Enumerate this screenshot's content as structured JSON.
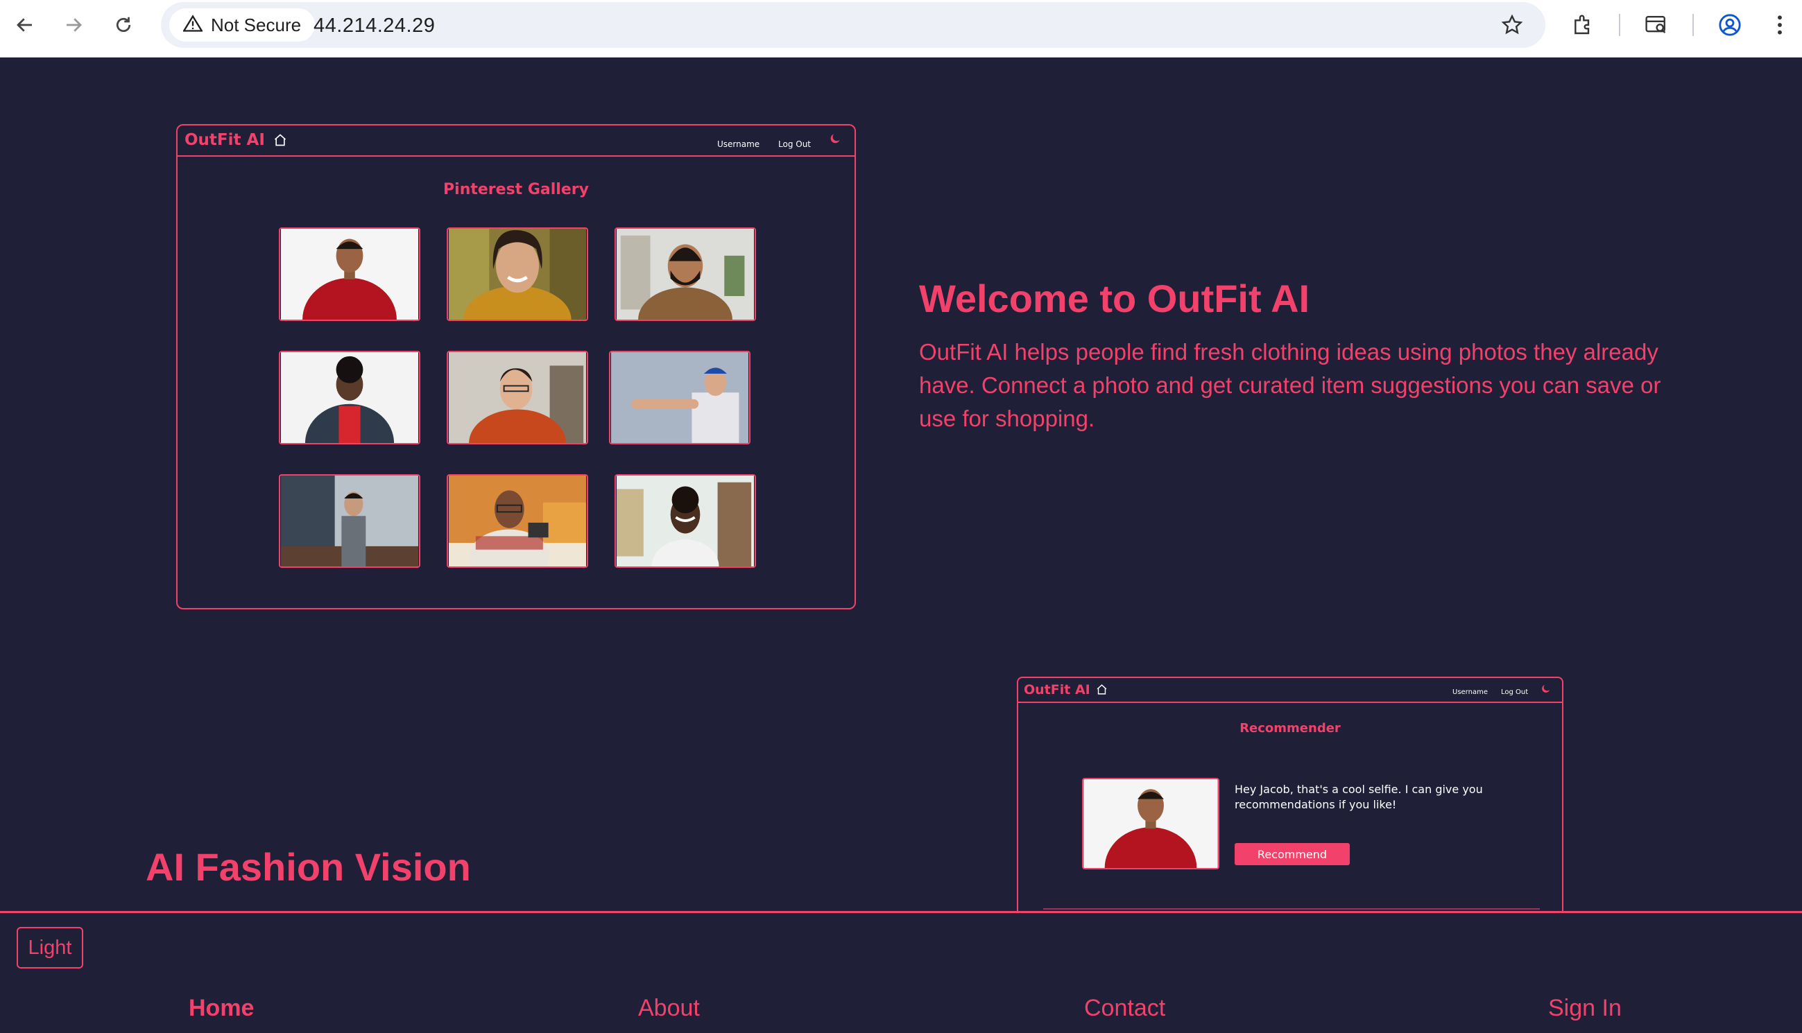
{
  "browser": {
    "security_label": "Not Secure",
    "url": "44.214.24.29",
    "icons": [
      "back-arrow-icon",
      "forward-arrow-icon",
      "reload-icon",
      "warning-icon",
      "bookmark-star-icon",
      "extensions-icon",
      "tab-search-icon",
      "profile-icon",
      "menu-dots-icon"
    ]
  },
  "gallery_mock": {
    "brand": "OutFit AI",
    "username": "Username",
    "logout": "Log Out",
    "title": "Pinterest Gallery"
  },
  "hero": {
    "title": "Welcome to OutFit AI",
    "text": "OutFit AI helps people find fresh clothing ideas using photos they already have. Connect a photo and get curated item suggestions you can save or use for shopping."
  },
  "recommender_mock": {
    "brand": "OutFit AI",
    "username": "Username",
    "logout": "Log Out",
    "title": "Recommender",
    "message": "Hey Jacob, that's a cool selfie.  I can give you recommendations if you like!",
    "button": "Recommend"
  },
  "section": {
    "title": "AI Fashion Vision"
  },
  "footer": {
    "theme_button": "Light",
    "nav": [
      "Home",
      "About",
      "Contact",
      "Sign In"
    ]
  },
  "colors": {
    "accent": "#f2416a",
    "background": "#1f1f37"
  }
}
